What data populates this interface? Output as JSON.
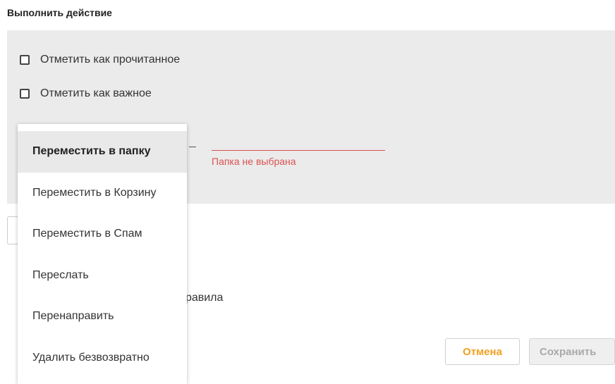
{
  "section": {
    "title": "Выполнить действие"
  },
  "options": {
    "mark_read": {
      "label": "Отметить как прочитанное",
      "checked": false
    },
    "mark_important": {
      "label": "Отметить как важное",
      "checked": false
    }
  },
  "folder": {
    "error": "Папка не выбрана"
  },
  "action_dropdown": {
    "items": [
      {
        "label": "Переместить в папку",
        "selected": true
      },
      {
        "label": "Переместить в Корзину"
      },
      {
        "label": "Переместить в Спам"
      },
      {
        "label": "Переслать"
      },
      {
        "label": "Перенаправить"
      },
      {
        "label": "Удалить безвозвратно"
      }
    ]
  },
  "partial_text": "ие правила",
  "footer": {
    "cancel_label": "Отмена",
    "save_label": "Сохранить"
  },
  "colors": {
    "accent": "#f0a020",
    "error": "#d9534f",
    "panel": "#ebebeb"
  }
}
